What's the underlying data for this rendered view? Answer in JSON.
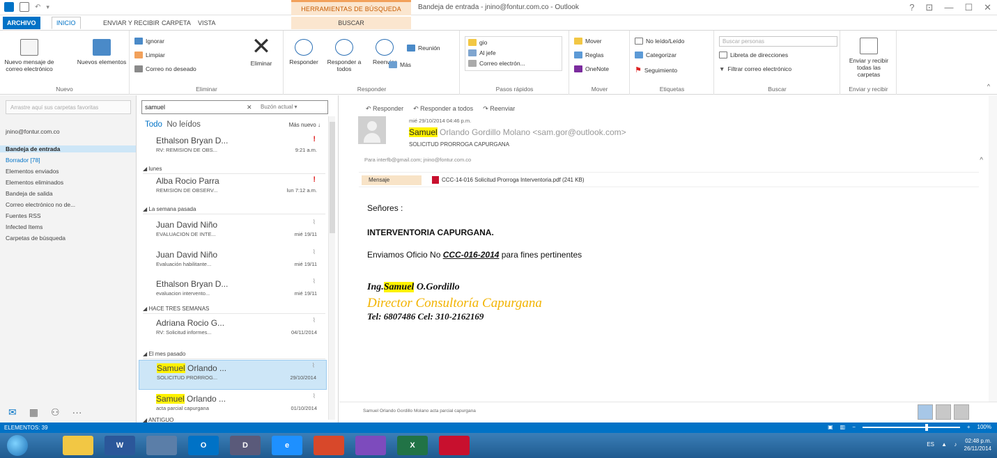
{
  "window": {
    "title": "Bandeja de entrada - jnino@fontur.com.co - Outlook",
    "context_tool": "HERRAMIENTAS DE BÚSQUEDA",
    "controls": [
      "?",
      "⊡",
      "—",
      "☐",
      "✕"
    ]
  },
  "tabs": [
    "ARCHIVO",
    "INICIO",
    "ENVIAR Y RECIBIR",
    "CARPETA",
    "VISTA",
    "BUSCAR"
  ],
  "ribbon": {
    "nuevo": {
      "new_email": "Nuevo mensaje de correo electrónico",
      "new_items": "Nuevos elementos",
      "label": "Nuevo"
    },
    "eliminar": {
      "ignore": "Ignorar",
      "clean": "Limpiar",
      "junk": "Correo no deseado",
      "delete": "Eliminar",
      "label": "Eliminar"
    },
    "responder": {
      "reply": "Responder",
      "reply_all": "Responder a todos",
      "forward": "Reenviar",
      "meeting": "Reunión",
      "more": "Más",
      "label": "Responder"
    },
    "pasos": {
      "items": [
        "gio",
        "Al jefe",
        "Correo electrón..."
      ],
      "label": "Pasos rápidos"
    },
    "mover": {
      "move": "Mover",
      "rules": "Reglas",
      "onenote": "OneNote",
      "label": "Mover"
    },
    "etiquetas": {
      "read": "No leído/Leído",
      "categorize": "Categorizar",
      "followup": "Seguimiento",
      "label": "Etiquetas"
    },
    "buscar": {
      "placeholder": "Buscar personas",
      "address_book": "Libreta de direcciones",
      "filter": "Filtrar correo electrónico",
      "label": "Buscar"
    },
    "enviar": {
      "send_all": "Enviar y recibir todas las carpetas",
      "label": "Enviar y recibir"
    }
  },
  "folders": {
    "search_placeholder": "Arrastre aquí sus carpetas favoritas",
    "account": "jnino@fontur.com.co",
    "items": [
      "Bandeja de entrada",
      "Borrador [78]",
      "Elementos enviados",
      "Elementos eliminados",
      "Bandeja de salida",
      "Correo electrónico no de...",
      "Fuentes RSS",
      "Infected Items",
      "Carpetas de búsqueda"
    ]
  },
  "list": {
    "search_value": "samuel",
    "search_clear": "✕",
    "search_scope": "Buzón actual",
    "filter_all": "Todo",
    "filter_unread": "No leídos",
    "sort": "Más nuevo",
    "groups": [
      "lunes",
      "La semana pasada",
      "HACE TRES SEMANAS",
      "El mes pasado",
      "ANTIGUO"
    ],
    "messages": [
      {
        "sender": "Ethalson Bryan D...",
        "subject": "RV: REMISION DE OBS...",
        "date": "9:21 a.m."
      },
      {
        "sender": "Alba Rocio Parra",
        "subject": "REMISION DE OBSERV...",
        "date": "lun 7:12 a.m."
      },
      {
        "sender": "Juan David Niño",
        "subject": "EVALUACION DE INTE...",
        "date": "mié 19/11"
      },
      {
        "sender": "Juan David Niño",
        "subject": "Evaluación habilitante...",
        "date": "mié 19/11"
      },
      {
        "sender": "Ethalson Bryan D...",
        "subject": "evaluacion intervento...",
        "date": "mié 19/11"
      },
      {
        "sender": "Adriana Rocio G...",
        "subject": "RV: Solicitud informes...",
        "date": "04/11/2014"
      },
      {
        "sender_hl": "Samuel",
        "sender": " Orlando ...",
        "subject": "SOLICITUD PRORROG...",
        "date": "29/10/2014"
      },
      {
        "sender_hl": "Samuel",
        "sender": " Orlando ...",
        "subject": "acta parcial capurgana",
        "date": "01/10/2014"
      }
    ]
  },
  "reading": {
    "actions": [
      "Responder",
      "Responder a todos",
      "Reenviar"
    ],
    "date": "mié 29/10/2014 04:46 p.m.",
    "from_hl": "Samuel",
    "from_rest": " Orlando Gordillo Molano <sam.gor@outlook.com>",
    "subject": "SOLICITUD PRORROGA CAPURGANA",
    "to": "Para   interfb@gmail.com; jnino@fontur.com.co",
    "msg_tab": "Mensaje",
    "attachment": "CCC-14-016 Solicitud Prorroga Interventoria.pdf (241 KB)",
    "body_greeting": "Señores :",
    "body_title": "INTERVENTORIA CAPURGANA.",
    "body_line_pre": "Enviamos Oficio No ",
    "body_line_ref": "CCC-016-2014",
    "body_line_post": " para fines pertinentes",
    "sig_pre": "Ing.",
    "sig_name_hl": "Samuel",
    "sig_name_rest": " O.Gordillo",
    "sig_role": "Director Consultoría Capurgana",
    "sig_phone": "Tel: 6807486  Cel: 310-2162169",
    "people_pane": "Samuel Orlando Gordillo Molano  acta parcial capurgana"
  },
  "status": {
    "items": "ELEMENTOS: 39",
    "zoom": "100%"
  },
  "taskbar": {
    "lang": "ES",
    "time": "02:48 p.m.",
    "date": "26/11/2014"
  }
}
